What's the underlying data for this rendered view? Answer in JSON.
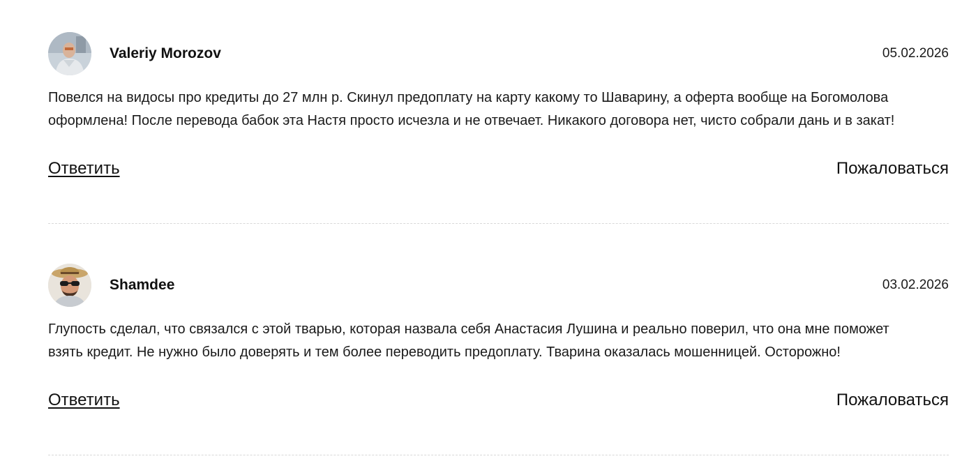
{
  "comments": [
    {
      "author": "Valeriy Morozov",
      "date": "05.02.2026",
      "text": "Повелся на видосы про кредиты до 27 млн р. Скинул предоплату на карту какому то Шаварину, а оферта вообще на Богомолова оформлена! После перевода бабок эта Настя просто исчезла и не отвечает. Никакого договора нет, чисто собрали дань и в закат!",
      "reply_label": "Ответить",
      "report_label": "Пожаловаться"
    },
    {
      "author": "Shamdee",
      "date": "03.02.2026",
      "text": "Глупость сделал, что связался с этой тварью, которая назвала себя Анастасия Лушина и реально поверил, что она мне поможет взять кредит. Не нужно было доверять и тем более переводить предоплату. Тварина оказалась мошенницей. Осторожно!",
      "reply_label": "Ответить",
      "report_label": "Пожаловаться"
    }
  ],
  "colors": {
    "text": "#1a1a1a",
    "divider": "#d8d8d8",
    "background": "#ffffff"
  }
}
